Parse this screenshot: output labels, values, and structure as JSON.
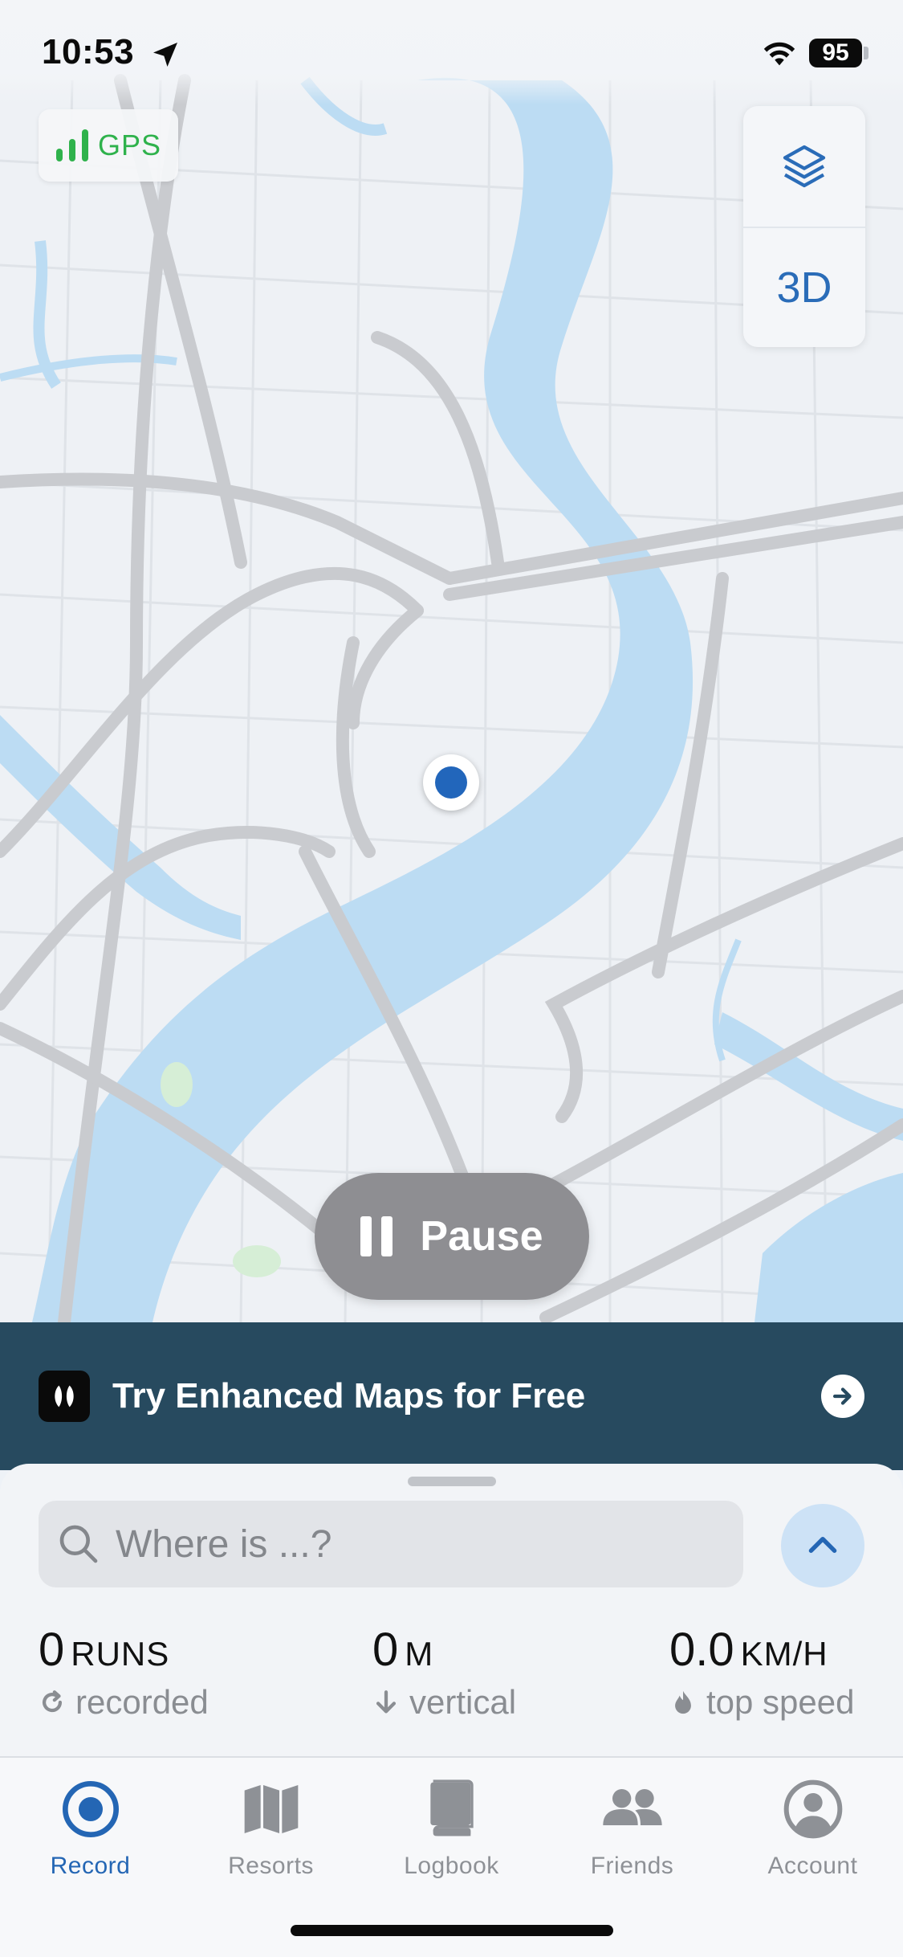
{
  "status_bar": {
    "time": "10:53",
    "battery": "95"
  },
  "map": {
    "gps_label": "GPS",
    "layers_icon": "layers-icon",
    "three_d_label": "3D",
    "colors": {
      "land": "#eef1f5",
      "water": "#bcdcf3",
      "road": "#c9cbcf",
      "location": "#2266bb"
    }
  },
  "pause_button": {
    "label": "Pause"
  },
  "banner": {
    "text": "Try Enhanced Maps for Free"
  },
  "search": {
    "placeholder": "Where is ...?"
  },
  "stats": {
    "runs": {
      "value": "0",
      "unit": "RUNS",
      "label": "recorded"
    },
    "vertical": {
      "value": "0",
      "unit": "M",
      "label": "vertical"
    },
    "speed": {
      "value": "0.0",
      "unit": "KM/H",
      "label": "top speed"
    }
  },
  "tabs": [
    {
      "label": "Record",
      "icon": "record-icon",
      "active": true
    },
    {
      "label": "Resorts",
      "icon": "map-icon",
      "active": false
    },
    {
      "label": "Logbook",
      "icon": "book-icon",
      "active": false
    },
    {
      "label": "Friends",
      "icon": "friends-icon",
      "active": false
    },
    {
      "label": "Account",
      "icon": "account-icon",
      "active": false
    }
  ],
  "accent_color": "#2466b4"
}
